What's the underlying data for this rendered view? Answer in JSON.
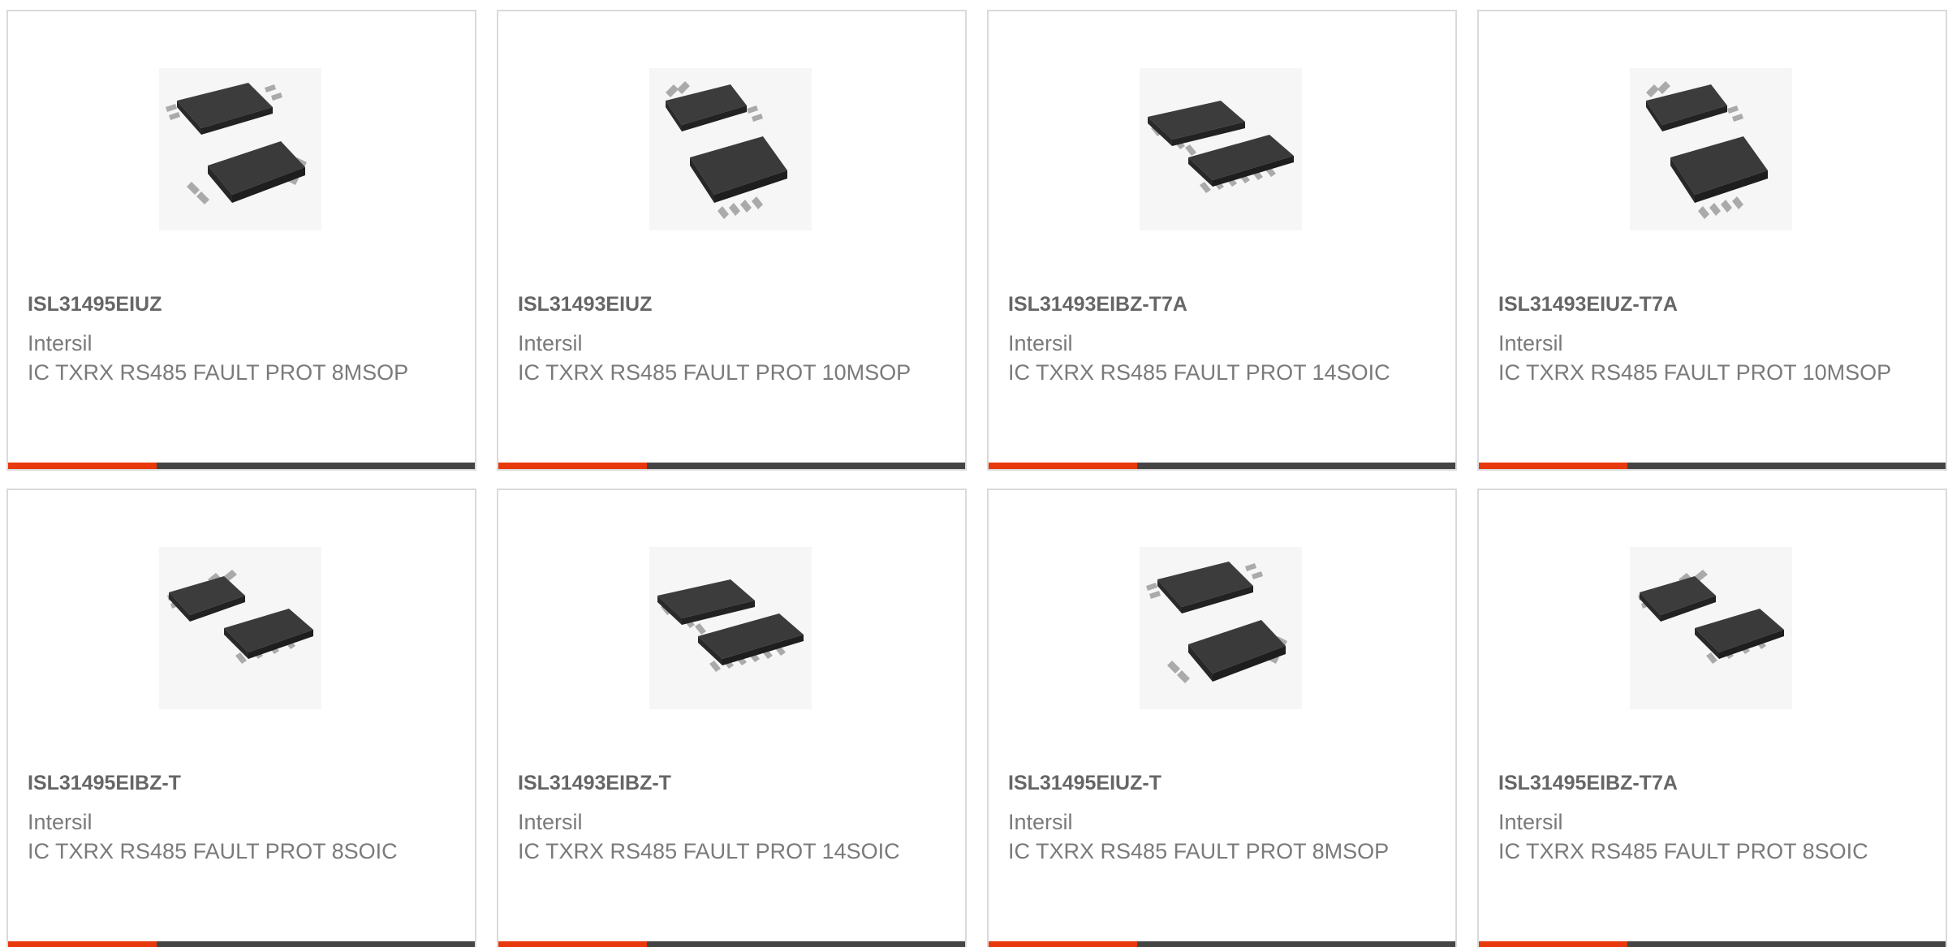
{
  "colors": {
    "accent": "#e8390e",
    "bar": "#444444",
    "border": "#dadada"
  },
  "products": [
    {
      "part_number": "ISL31495EIUZ",
      "manufacturer": "Intersil",
      "description": "IC TXRX RS485 FAULT PROT 8MSOP",
      "image_icon": "msop-chip-icon"
    },
    {
      "part_number": "ISL31493EIUZ",
      "manufacturer": "Intersil",
      "description": "IC TXRX RS485 FAULT PROT 10MSOP",
      "image_icon": "msop-chip-icon"
    },
    {
      "part_number": "ISL31493EIBZ-T7A",
      "manufacturer": "Intersil",
      "description": "IC TXRX RS485 FAULT PROT 14SOIC",
      "image_icon": "soic-chip-icon"
    },
    {
      "part_number": "ISL31493EIUZ-T7A",
      "manufacturer": "Intersil",
      "description": "IC TXRX RS485 FAULT PROT 10MSOP",
      "image_icon": "msop-chip-icon"
    },
    {
      "part_number": "ISL31495EIBZ-T",
      "manufacturer": "Intersil",
      "description": "IC TXRX RS485 FAULT PROT 8SOIC",
      "image_icon": "soic-chip-icon"
    },
    {
      "part_number": "ISL31493EIBZ-T",
      "manufacturer": "Intersil",
      "description": "IC TXRX RS485 FAULT PROT 14SOIC",
      "image_icon": "soic-chip-icon"
    },
    {
      "part_number": "ISL31495EIUZ-T",
      "manufacturer": "Intersil",
      "description": "IC TXRX RS485 FAULT PROT 8MSOP",
      "image_icon": "msop-chip-icon"
    },
    {
      "part_number": "ISL31495EIBZ-T7A",
      "manufacturer": "Intersil",
      "description": "IC TXRX RS485 FAULT PROT 8SOIC",
      "image_icon": "soic-chip-icon"
    }
  ]
}
